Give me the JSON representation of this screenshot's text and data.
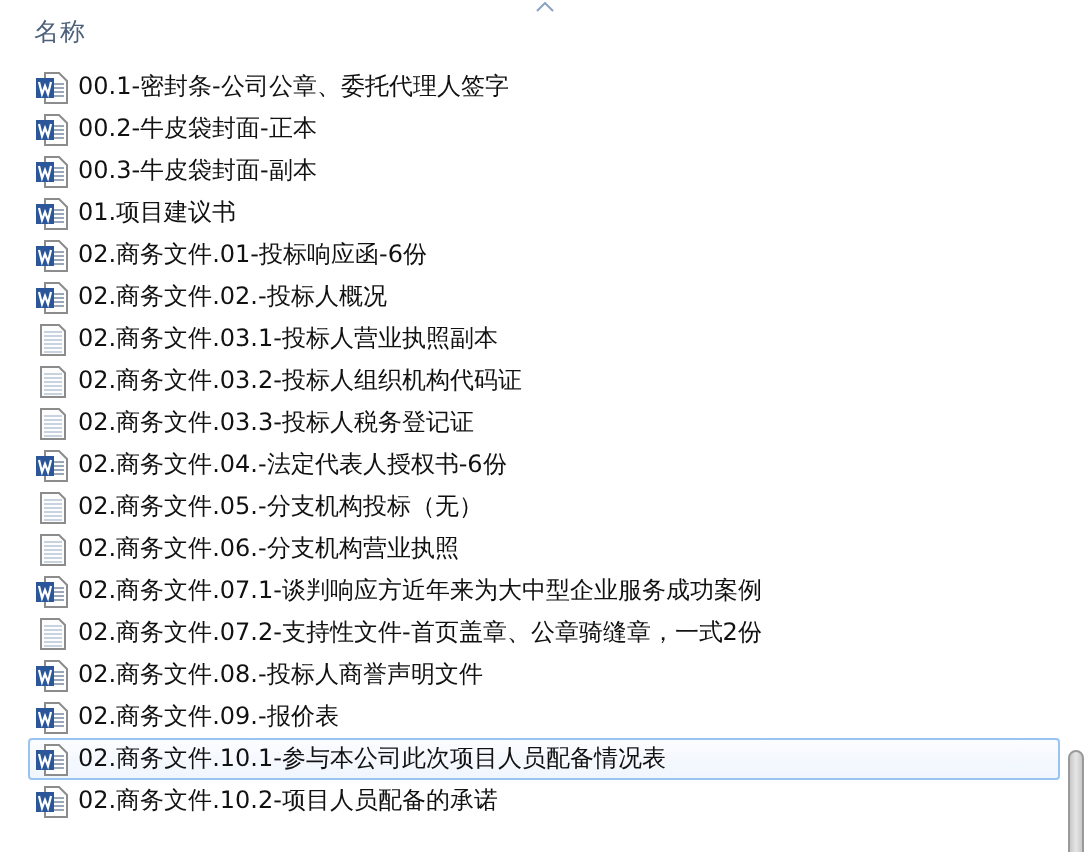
{
  "header": {
    "name_column": "名称",
    "sorted_ascending": true
  },
  "files": [
    {
      "name": "00.1-密封条-公司公章、委托代理人签字",
      "kind": "word",
      "selected": false
    },
    {
      "name": "00.2-牛皮袋封面-正本",
      "kind": "word",
      "selected": false
    },
    {
      "name": "00.3-牛皮袋封面-副本",
      "kind": "word",
      "selected": false
    },
    {
      "name": "01.项目建议书",
      "kind": "word",
      "selected": false
    },
    {
      "name": "02.商务文件.01-投标响应函-6份",
      "kind": "word",
      "selected": false
    },
    {
      "name": "02.商务文件.02.-投标人概况",
      "kind": "word",
      "selected": false
    },
    {
      "name": "02.商务文件.03.1-投标人营业执照副本",
      "kind": "text",
      "selected": false
    },
    {
      "name": "02.商务文件.03.2-投标人组织机构代码证",
      "kind": "text",
      "selected": false
    },
    {
      "name": "02.商务文件.03.3-投标人税务登记证",
      "kind": "text",
      "selected": false
    },
    {
      "name": "02.商务文件.04.-法定代表人授权书-6份",
      "kind": "word",
      "selected": false
    },
    {
      "name": "02.商务文件.05.-分支机构投标（无）",
      "kind": "text",
      "selected": false
    },
    {
      "name": "02.商务文件.06.-分支机构营业执照",
      "kind": "text",
      "selected": false
    },
    {
      "name": "02.商务文件.07.1-谈判响应方近年来为大中型企业服务成功案例",
      "kind": "word",
      "selected": false
    },
    {
      "name": "02.商务文件.07.2-支持性文件-首页盖章、公章骑缝章，一式2份",
      "kind": "text",
      "selected": false
    },
    {
      "name": "02.商务文件.08.-投标人商誉声明文件",
      "kind": "word",
      "selected": false
    },
    {
      "name": "02.商务文件.09.-报价表",
      "kind": "word",
      "selected": false
    },
    {
      "name": "02.商务文件.10.1-参与本公司此次项目人员配备情况表",
      "kind": "word",
      "selected": true
    },
    {
      "name": "02.商务文件.10.2-项目人员配备的承诺",
      "kind": "word",
      "selected": false
    }
  ]
}
